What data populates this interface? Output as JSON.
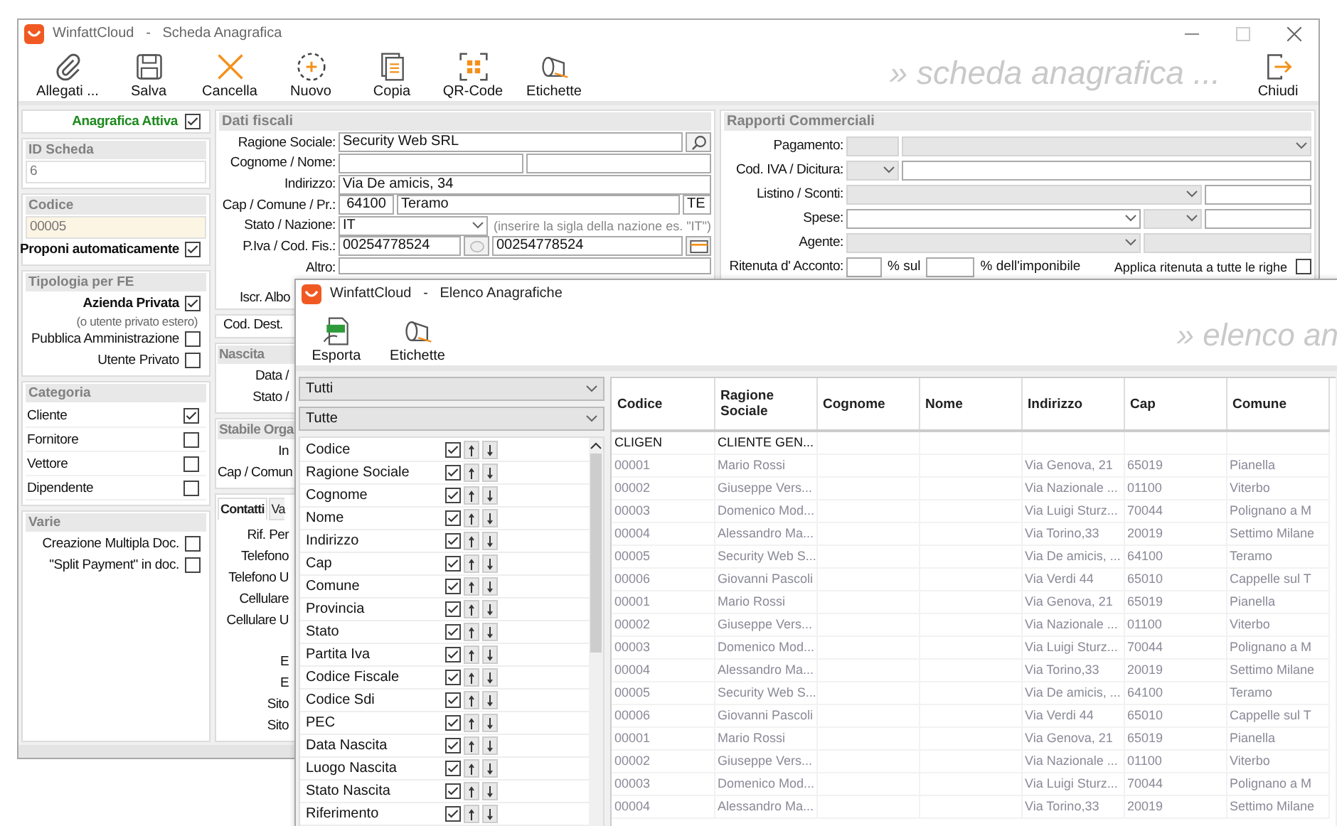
{
  "main_window": {
    "title": "WinfattCloud   -   Scheda Anagrafica",
    "watermark": "» scheda anagrafica ...",
    "toolbar": [
      {
        "label": "Allegati ...",
        "kind": "attach"
      },
      {
        "label": "Salva",
        "kind": "save"
      },
      {
        "label": "Cancella",
        "kind": "delete"
      },
      {
        "label": "Nuovo",
        "kind": "new"
      },
      {
        "label": "Copia",
        "kind": "copy"
      },
      {
        "label": "QR-Code",
        "kind": "qr"
      },
      {
        "label": "Etichette",
        "kind": "labels"
      }
    ],
    "close_button": {
      "label": "Chiudi"
    },
    "left": {
      "active": {
        "label": "Anagrafica Attiva",
        "checked": true
      },
      "id_scheda": {
        "title": "ID Scheda",
        "value": "6"
      },
      "codice": {
        "title": "Codice",
        "value": "00005",
        "auto": {
          "label": "Proponi automaticamente",
          "checked": true
        }
      },
      "tipologia": {
        "title": "Tipologia per FE",
        "options": [
          {
            "label": "Azienda Privata",
            "note": "(o utente privato estero)",
            "checked": true
          },
          {
            "label": "Pubblica Amministrazione",
            "checked": false
          },
          {
            "label": "Utente Privato",
            "checked": false
          }
        ]
      },
      "categoria": {
        "title": "Categoria",
        "items": [
          {
            "label": "Cliente",
            "checked": true
          },
          {
            "label": "Fornitore",
            "checked": false
          },
          {
            "label": "Vettore",
            "checked": false
          },
          {
            "label": "Dipendente",
            "checked": false
          }
        ]
      },
      "varie": {
        "title": "Varie",
        "items": [
          {
            "label": "Creazione Multipla Doc.",
            "checked": false
          },
          {
            "label": "\"Split Payment\" in doc.",
            "checked": false
          }
        ]
      }
    },
    "dati_fiscali": {
      "title": "Dati fiscali",
      "ragione_sociale": {
        "label": "Ragione Sociale:",
        "value": "Security Web SRL"
      },
      "cognome_nome": {
        "label": "Cognome / Nome:"
      },
      "indirizzo": {
        "label": "Indirizzo:",
        "value": "Via De amicis, 34"
      },
      "cap_comune": {
        "label": "Cap / Comune / Pr.:",
        "cap": "64100",
        "comune": "Teramo",
        "provincia": "TE"
      },
      "stato": {
        "label": "Stato / Nazione:",
        "value": "IT",
        "hint": "(inserire la sigla della nazione es. \"IT\")"
      },
      "piva": {
        "label": "P.Iva / Cod. Fis.:",
        "piva": "00254778524",
        "codice_fiscale": "00254778524"
      },
      "altro": {
        "label": "Altro:"
      },
      "iscr_albo": {
        "label": "Iscr. Albo"
      }
    },
    "cod_dest": {
      "label": "Cod. Dest."
    },
    "nascita": {
      "title": "Nascita",
      "labels": [
        "Data /",
        "Stato /"
      ]
    },
    "stabile": {
      "title": "Stabile Orga",
      "labels": [
        "In",
        "Cap / Comun"
      ]
    },
    "contatti": {
      "tabs": [
        {
          "label": "Contatti",
          "selected": true
        },
        {
          "label": "Va",
          "selected": false
        }
      ],
      "labels": [
        "Rif. Per",
        "Telefono",
        "Telefono U",
        "Cellulare",
        "Cellulare U",
        "E",
        "E",
        "Sito",
        "Sito"
      ]
    },
    "rapporti": {
      "title": "Rapporti Commerciali",
      "rows": [
        {
          "label": "Pagamento:",
          "fields": [
            {
              "kind": "input",
              "disabled": true
            },
            {
              "kind": "dropdown",
              "disabled": true
            }
          ]
        },
        {
          "label": "Cod. IVA / Dicitura:",
          "fields": [
            {
              "kind": "dropdown",
              "disabled": true
            },
            {
              "kind": "input",
              "disabled": false
            }
          ]
        },
        {
          "label": "Listino / Sconti:",
          "fields": [
            {
              "kind": "dropdown",
              "disabled": true
            },
            {
              "kind": "input",
              "disabled": false
            }
          ]
        },
        {
          "label": "Spese:",
          "fields": [
            {
              "kind": "dropdown",
              "disabled": false
            },
            {
              "kind": "dropdown",
              "disabled": true
            },
            {
              "kind": "input",
              "disabled": false
            }
          ]
        },
        {
          "label": "Agente:",
          "fields": [
            {
              "kind": "dropdown",
              "disabled": true
            },
            {
              "kind": "input",
              "disabled": true
            }
          ]
        }
      ],
      "ritenuta": {
        "label": "Ritenuta d' Acconto:",
        "sul": "% sul",
        "imponibile": "% dell'imponibile"
      },
      "applica": {
        "label": "Applica ritenuta a tutte le righe",
        "checked": false
      }
    }
  },
  "list_window": {
    "title": "WinfattCloud   -   Elenco Anagrafiche",
    "watermark": "» elenco an",
    "toolbar": [
      {
        "label": "Esporta",
        "kind": "export"
      },
      {
        "label": "Etichette",
        "kind": "labels"
      }
    ],
    "filters": [
      "Tutti",
      "Tutte"
    ],
    "fields": [
      {
        "label": "Codice",
        "checked": true
      },
      {
        "label": "Ragione Sociale",
        "checked": true
      },
      {
        "label": "Cognome",
        "checked": true
      },
      {
        "label": "Nome",
        "checked": true
      },
      {
        "label": "Indirizzo",
        "checked": true
      },
      {
        "label": "Cap",
        "checked": true
      },
      {
        "label": "Comune",
        "checked": true
      },
      {
        "label": "Provincia",
        "checked": true
      },
      {
        "label": "Stato",
        "checked": true
      },
      {
        "label": "Partita Iva",
        "checked": true
      },
      {
        "label": "Codice Fiscale",
        "checked": true
      },
      {
        "label": "Codice Sdi",
        "checked": true
      },
      {
        "label": "PEC",
        "checked": true
      },
      {
        "label": "Data Nascita",
        "checked": true
      },
      {
        "label": "Luogo Nascita",
        "checked": true
      },
      {
        "label": "Stato Nascita",
        "checked": true
      },
      {
        "label": "Riferimento",
        "checked": true
      }
    ],
    "table": {
      "columns": [
        "Codice",
        "Ragione Sociale",
        "Cognome",
        "Nome",
        "Indirizzo",
        "Cap",
        "Comune"
      ],
      "rows": [
        {
          "codice": "CLIGEN",
          "ragione_sociale": "CLIENTE GEN...",
          "dimmed": false
        },
        {
          "codice": "00001",
          "ragione_sociale": "Mario Rossi",
          "indirizzo": "Via Genova, 21",
          "cap": "65019",
          "comune": "Pianella",
          "dimmed": true
        },
        {
          "codice": "00002",
          "ragione_sociale": "Giuseppe Vers...",
          "indirizzo": "Via Nazionale ...",
          "cap": "01100",
          "comune": "Viterbo",
          "dimmed": true
        },
        {
          "codice": "00003",
          "ragione_sociale": "Domenico Mod...",
          "indirizzo": "Via Luigi Sturz...",
          "cap": "70044",
          "comune": "Polignano a M",
          "dimmed": true
        },
        {
          "codice": "00004",
          "ragione_sociale": "Alessandro Ma...",
          "indirizzo": "Via Torino,33",
          "cap": "20019",
          "comune": "Settimo Milane",
          "dimmed": true
        },
        {
          "codice": "00005",
          "ragione_sociale": "Security Web S...",
          "indirizzo": "Via De amicis, ...",
          "cap": "64100",
          "comune": "Teramo",
          "dimmed": true
        },
        {
          "codice": "00006",
          "ragione_sociale": "Giovanni Pascoli",
          "indirizzo": "Via Verdi 44",
          "cap": "65010",
          "comune": "Cappelle sul T",
          "dimmed": true
        },
        {
          "codice": "00001",
          "ragione_sociale": "Mario Rossi",
          "indirizzo": "Via Genova, 21",
          "cap": "65019",
          "comune": "Pianella",
          "dimmed": true
        },
        {
          "codice": "00002",
          "ragione_sociale": "Giuseppe Vers...",
          "indirizzo": "Via Nazionale ...",
          "cap": "01100",
          "comune": "Viterbo",
          "dimmed": true
        },
        {
          "codice": "00003",
          "ragione_sociale": "Domenico Mod...",
          "indirizzo": "Via Luigi Sturz...",
          "cap": "70044",
          "comune": "Polignano a M",
          "dimmed": true
        },
        {
          "codice": "00004",
          "ragione_sociale": "Alessandro Ma...",
          "indirizzo": "Via Torino,33",
          "cap": "20019",
          "comune": "Settimo Milane",
          "dimmed": true
        },
        {
          "codice": "00005",
          "ragione_sociale": "Security Web S...",
          "indirizzo": "Via De amicis, ...",
          "cap": "64100",
          "comune": "Teramo",
          "dimmed": true
        },
        {
          "codice": "00006",
          "ragione_sociale": "Giovanni Pascoli",
          "indirizzo": "Via Verdi 44",
          "cap": "65010",
          "comune": "Cappelle sul T",
          "dimmed": true
        },
        {
          "codice": "00001",
          "ragione_sociale": "Mario Rossi",
          "indirizzo": "Via Genova, 21",
          "cap": "65019",
          "comune": "Pianella",
          "dimmed": true
        },
        {
          "codice": "00002",
          "ragione_sociale": "Giuseppe Vers...",
          "indirizzo": "Via Nazionale ...",
          "cap": "01100",
          "comune": "Viterbo",
          "dimmed": true
        },
        {
          "codice": "00003",
          "ragione_sociale": "Domenico Mod...",
          "indirizzo": "Via Luigi Sturz...",
          "cap": "70044",
          "comune": "Polignano a M",
          "dimmed": true
        },
        {
          "codice": "00004",
          "ragione_sociale": "Alessandro Ma...",
          "indirizzo": "Via Torino,33",
          "cap": "20019",
          "comune": "Settimo Milane",
          "dimmed": true
        }
      ]
    }
  }
}
